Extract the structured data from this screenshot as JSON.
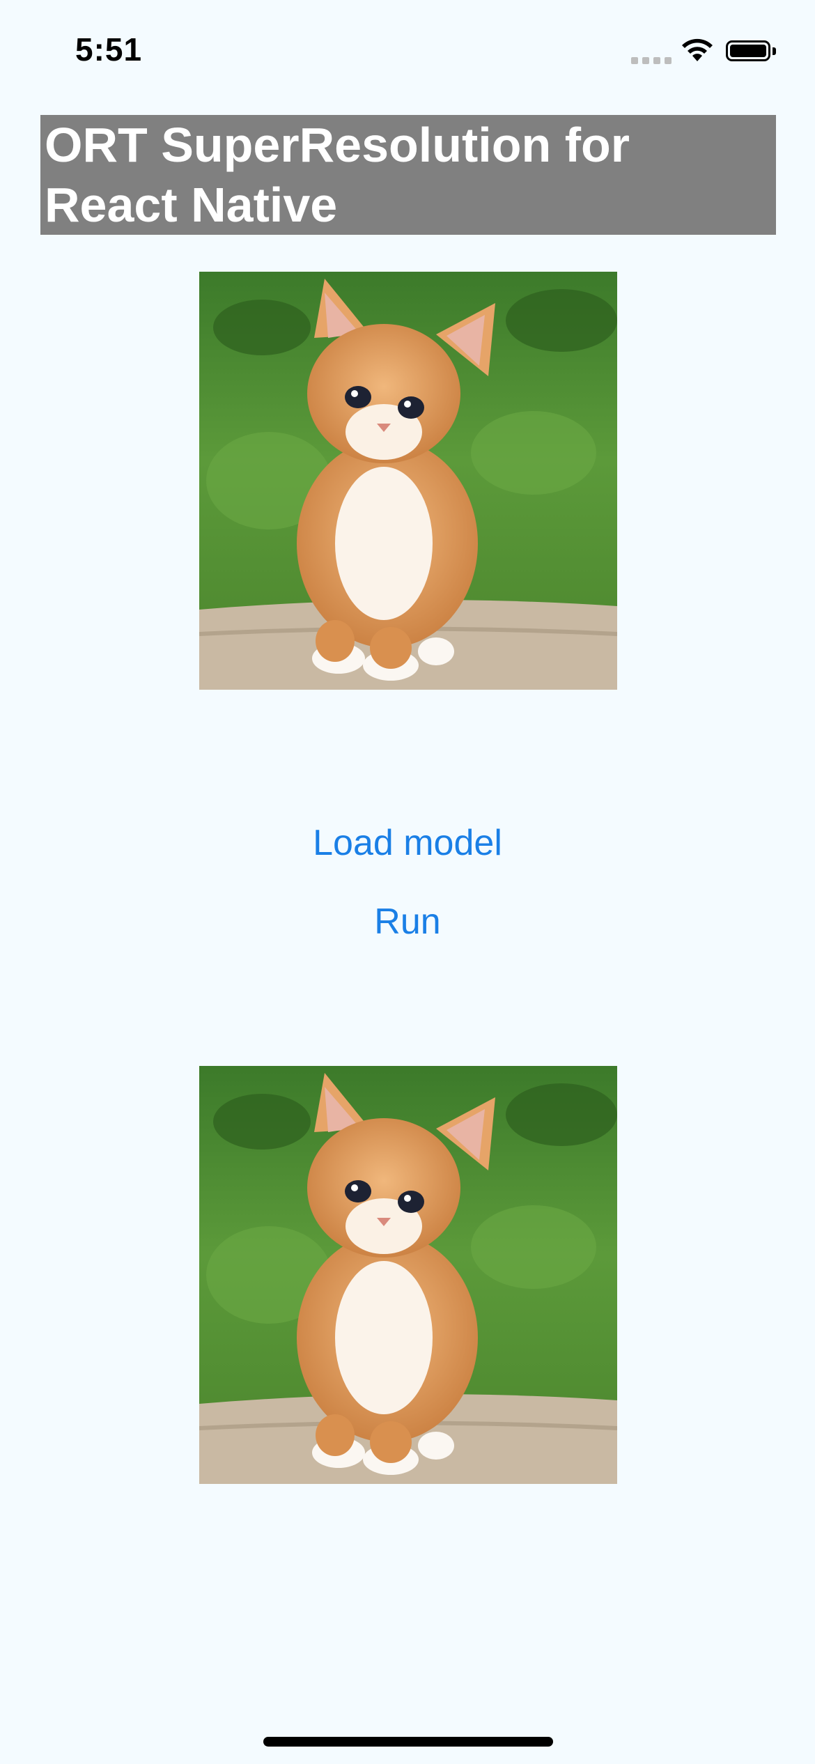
{
  "status_bar": {
    "time": "5:51",
    "icons": [
      "signal-icon",
      "wifi-icon",
      "battery-icon"
    ]
  },
  "header": {
    "title": "ORT SuperResolution for React Native"
  },
  "images": {
    "input": {
      "description_icon": "kitten-photo-icon"
    },
    "output": {
      "description_icon": "kitten-photo-icon"
    }
  },
  "buttons": {
    "load_model": "Load model",
    "run": "Run"
  },
  "colors": {
    "background": "#f4fbff",
    "title_bar": "#808080",
    "title_text": "#ffffff",
    "button_text": "#1a7fe6"
  }
}
